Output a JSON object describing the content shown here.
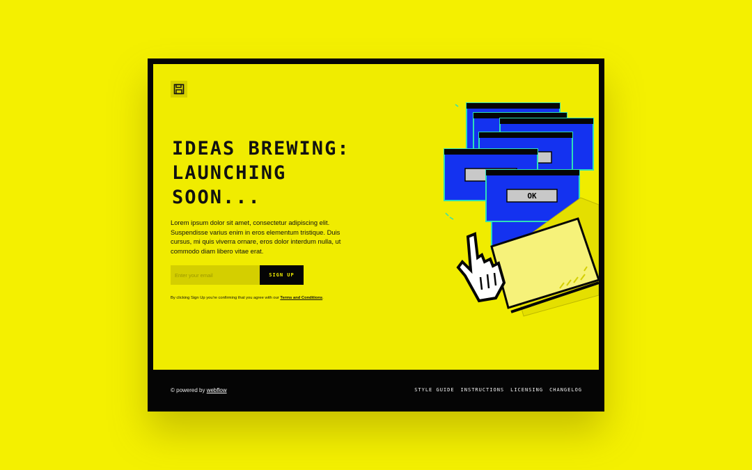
{
  "hero": {
    "headline": [
      "IDEAS BREWING:",
      "LAUNCHING",
      "SOON..."
    ],
    "description": "Lorem ipsum dolor sit amet, consectetur adipiscing elit. Suspendisse varius enim in eros elementum tristique. Duis cursus, mi quis viverra ornare, eros dolor interdum nulla, ut commodo diam libero vitae erat."
  },
  "form": {
    "email_placeholder": "Enter your email",
    "email_value": "",
    "button_label": "SIGN UP",
    "disclaimer_prefix": "By clicking Sign Up you're confirming that you agree with our ",
    "terms_link": "Terms and Conditions",
    "disclaimer_suffix": "."
  },
  "illustration": {
    "ok_label": "OK"
  },
  "footer": {
    "powered_prefix": "© powered by ",
    "powered_link": "webflow",
    "nav": [
      "STYLE GUIDE",
      "INSTRUCTIONS",
      "LICENSING",
      "CHANGELOG"
    ]
  },
  "colors": {
    "background": "#f4f000",
    "frame": "#050505",
    "window_blue": "#1432f0",
    "window_outline": "#2ee0b8"
  },
  "icons": {
    "logo": "floppy-disk-icon",
    "cursor": "pointing-hand-icon"
  }
}
